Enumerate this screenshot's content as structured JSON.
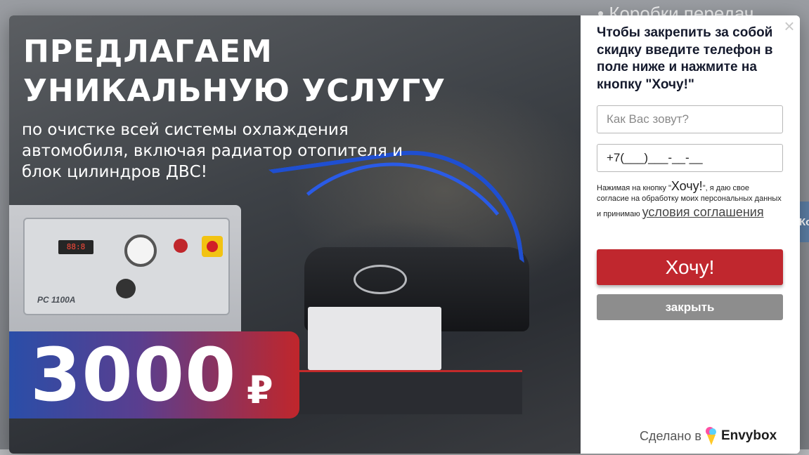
{
  "background_page": {
    "text_top": "• Коробки передач",
    "side_tab_text": "Ко"
  },
  "promo": {
    "title_line1": "ПРЕДЛАГАЕМ",
    "title_line2": "УНИКАЛЬНУЮ УСЛУГУ",
    "subtitle": "по очистке всей системы охлаждения автомобиля, включая радиатор отопителя и блок цилиндров ДВС!",
    "machine_brand": "PC 1100A",
    "price_value": "3000",
    "price_currency": "₽"
  },
  "form": {
    "close_icon": "×",
    "heading": "Чтобы закрепить за собой скидку введите телефон в поле ниже и нажмите на кнопку \"Хочу!\"",
    "name_placeholder": "Как Вас зовут?",
    "phone_value": "+7(___)___-__-__",
    "consent_prefix": "Нажимая на кнопку \"",
    "consent_button_word": "Хочу!",
    "consent_middle": "\", я даю свое согласие на обработку моих персональных данных и принимаю ",
    "consent_link": "условия соглашения",
    "submit_label": "Хочу!",
    "close_label": "закрыть",
    "made_by_prefix": "Сделано в",
    "made_by_brand": "Envybox"
  },
  "colors": {
    "submit_button": "#c0272e",
    "close_button": "#8d8d8d",
    "price_gradient_start": "#2a4ea8",
    "price_gradient_end": "#c0262b",
    "hose_blue": "#1f4fd1"
  }
}
